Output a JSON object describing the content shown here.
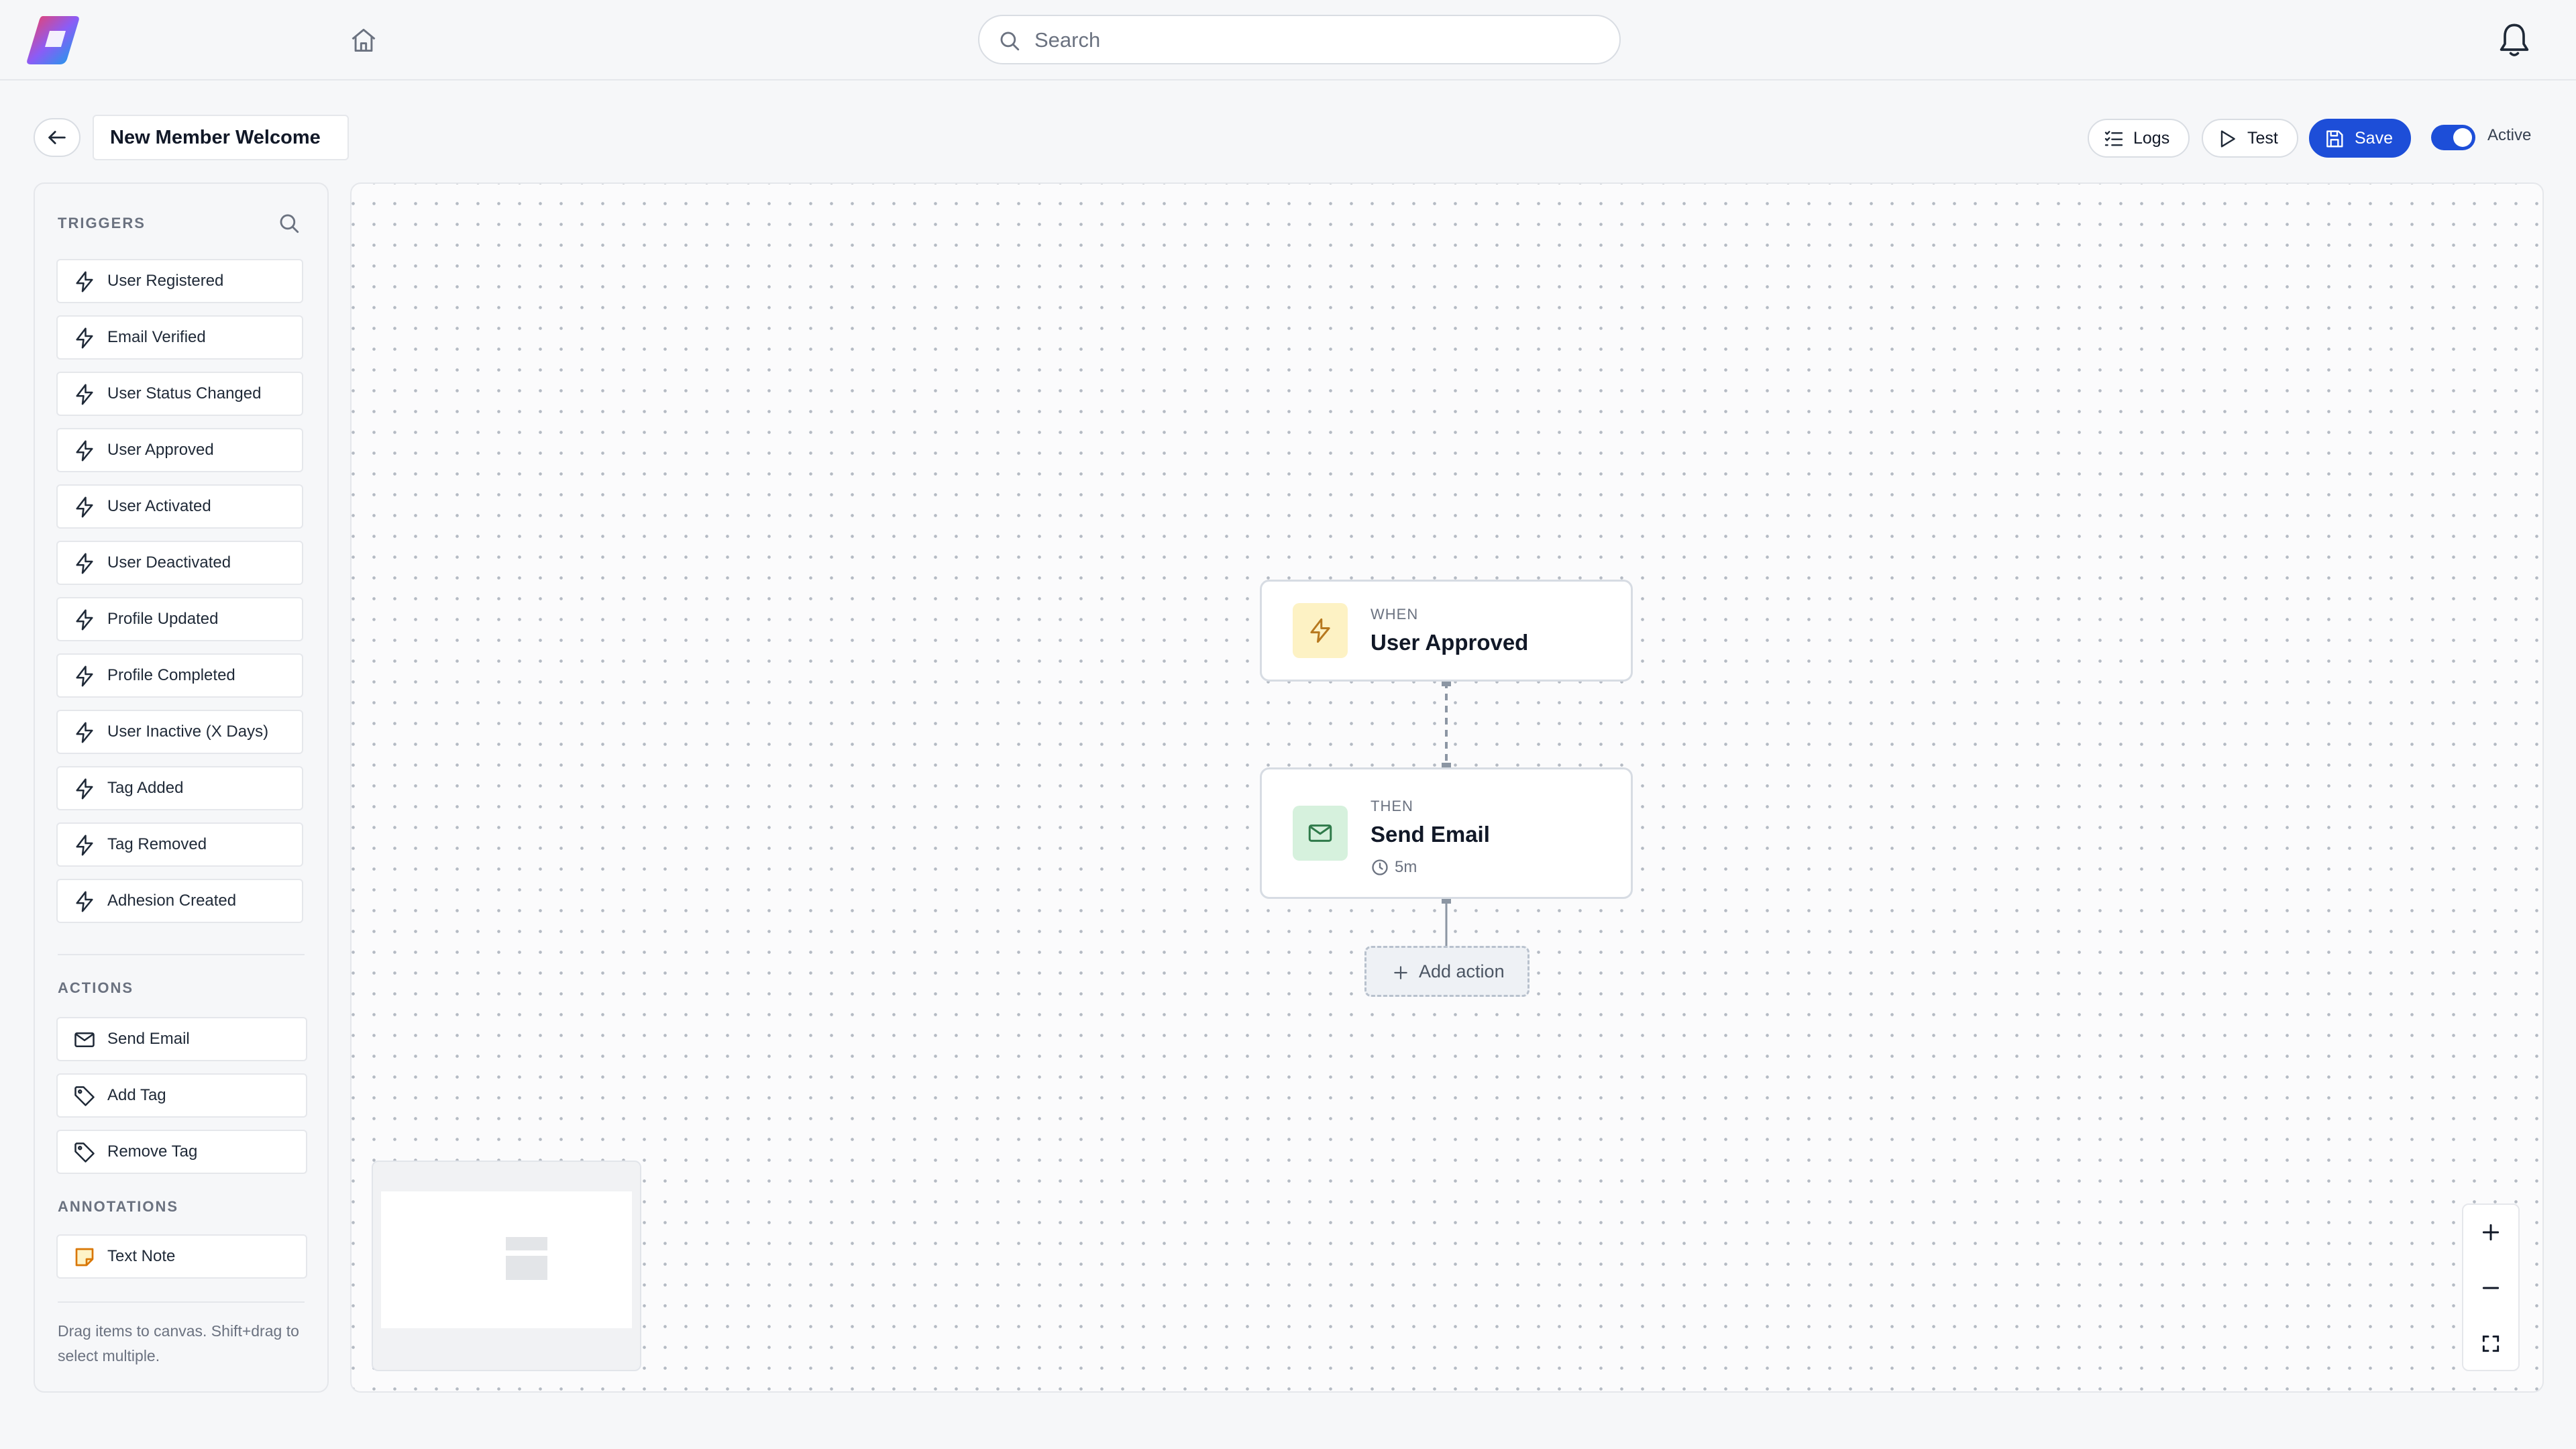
{
  "topbar": {
    "search_placeholder": "Search"
  },
  "header": {
    "workflow_name": "New Member Welcome",
    "logs_label": "Logs",
    "test_label": "Test",
    "save_label": "Save",
    "active_label": "Active",
    "active_on": true
  },
  "sidebar": {
    "triggers_title": "TRIGGERS",
    "triggers": [
      {
        "label": "User Registered",
        "icon": "lightning-icon"
      },
      {
        "label": "Email Verified",
        "icon": "lightning-icon"
      },
      {
        "label": "User Status Changed",
        "icon": "lightning-icon"
      },
      {
        "label": "User Approved",
        "icon": "lightning-icon"
      },
      {
        "label": "User Activated",
        "icon": "lightning-icon"
      },
      {
        "label": "User Deactivated",
        "icon": "lightning-icon"
      },
      {
        "label": "Profile Updated",
        "icon": "lightning-icon"
      },
      {
        "label": "Profile Completed",
        "icon": "lightning-icon"
      },
      {
        "label": "User Inactive (X Days)",
        "icon": "lightning-icon"
      },
      {
        "label": "Tag Added",
        "icon": "lightning-icon"
      },
      {
        "label": "Tag Removed",
        "icon": "lightning-icon"
      },
      {
        "label": "Adhesion Created",
        "icon": "lightning-icon"
      }
    ],
    "actions_title": "ACTIONS",
    "actions": [
      {
        "label": "Send Email",
        "icon": "mail-icon"
      },
      {
        "label": "Add Tag",
        "icon": "tag-icon"
      },
      {
        "label": "Remove Tag",
        "icon": "tag-icon"
      }
    ],
    "annotations_title": "ANNOTATIONS",
    "annotations": [
      {
        "label": "Text Note",
        "icon": "note-icon"
      }
    ],
    "hint": "Drag items to canvas. Shift+drag to select multiple."
  },
  "canvas": {
    "trigger_node": {
      "kicker": "WHEN",
      "title": "User Approved"
    },
    "action_node": {
      "kicker": "THEN",
      "title": "Send Email",
      "delay": "5m"
    },
    "add_action_label": "Add action"
  },
  "colors": {
    "accent": "#1d4ed8",
    "trigger_badge": "#fdf2c4",
    "action_badge": "#d6f1dd"
  }
}
